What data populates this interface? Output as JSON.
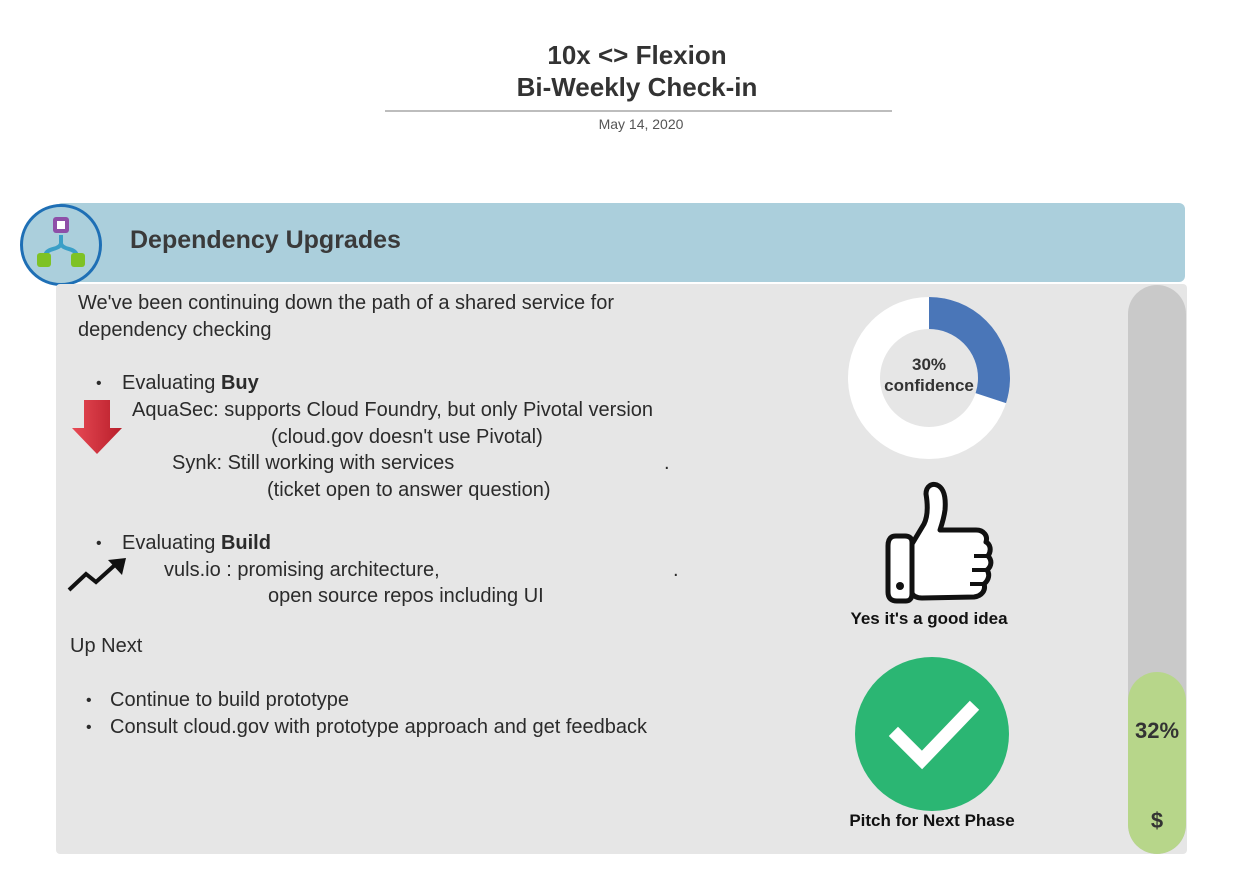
{
  "header": {
    "title_line1": "10x <> Flexion",
    "title_line2": "Bi-Weekly Check-in",
    "date": "May 14, 2020"
  },
  "section": {
    "title": "Dependency Upgrades",
    "icon": "hierarchy-icon"
  },
  "body": {
    "intro_line1": "We've been continuing down the path of a shared service for",
    "intro_line2": "dependency checking",
    "buy": {
      "bullet": "•",
      "prefix": "Evaluating ",
      "keyword": "Buy",
      "aquasec_line1": "AquaSec: supports Cloud Foundry, but only Pivotal version",
      "aquasec_line2": "(cloud.gov doesn't use Pivotal)",
      "synk_line1": "Synk: Still working with  services",
      "synk_dot": ".",
      "synk_line2": "(ticket open to answer question)",
      "indicator_icon": "down-arrow-icon"
    },
    "build": {
      "bullet": "•",
      "prefix": "Evaluating ",
      "keyword": "Build",
      "vuls_line1": "vuls.io : promising architecture,",
      "vuls_dot": ".",
      "vuls_line2": "open source repos including UI",
      "indicator_icon": "trend-up-icon"
    },
    "up_next": {
      "heading": "Up Next",
      "items": [
        "Continue to build prototype",
        "Consult cloud.gov with prototype approach and get feedback"
      ],
      "bullet": "•"
    }
  },
  "status": {
    "confidence": {
      "value_pct": 30,
      "label_value": "30%",
      "label_text": "confidence",
      "color": "#4a76b8",
      "track_color": "#ffffff"
    },
    "verdict": {
      "icon": "thumbs-up-icon",
      "caption": "Yes it's a good idea"
    },
    "next_step": {
      "icon": "checkmark-icon",
      "caption": "Pitch for Next Phase",
      "color": "#2bb673"
    },
    "budget": {
      "value_pct": 32,
      "label": "32%",
      "symbol": "$",
      "fill_color": "#b7d68a",
      "track_color": "#c9c9c9"
    }
  }
}
